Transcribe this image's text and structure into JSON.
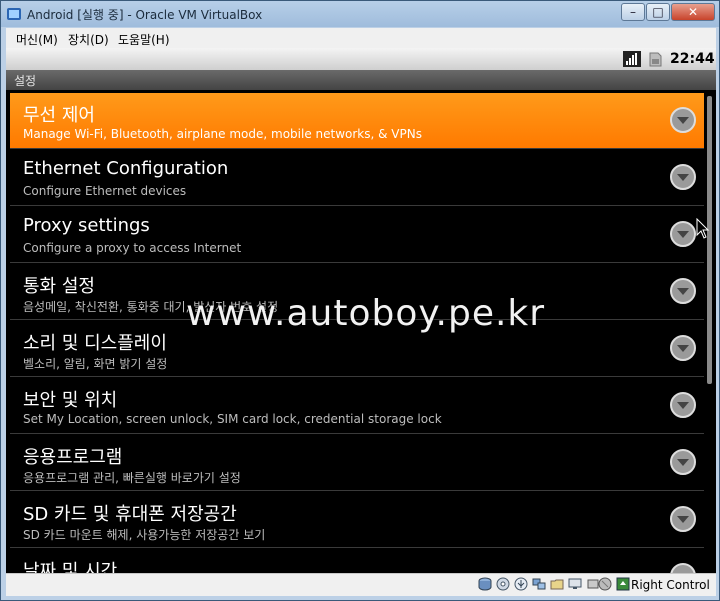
{
  "window": {
    "title": "Android [실행 중] - Oracle VM VirtualBox"
  },
  "menubar": {
    "items": [
      "머신(M)",
      "장치(D)",
      "도움말(H)"
    ]
  },
  "status": {
    "time": "22:44"
  },
  "appbar": {
    "title": "설정"
  },
  "settings": [
    {
      "title": "무선 제어",
      "subtitle": "Manage Wi-Fi, Bluetooth, airplane mode, mobile networks, & VPNs"
    },
    {
      "title": "Ethernet Configuration",
      "subtitle": "Configure Ethernet devices"
    },
    {
      "title": "Proxy settings",
      "subtitle": "Configure a proxy to access Internet"
    },
    {
      "title": "통화 설정",
      "subtitle": "음성메일, 착신전환, 통화중 대기, 발신자 번호 설정"
    },
    {
      "title": "소리 및 디스플레이",
      "subtitle": "벨소리, 알림, 화면 밝기 설정"
    },
    {
      "title": "보안 및 위치",
      "subtitle": "Set My Location, screen unlock, SIM card lock, credential storage lock"
    },
    {
      "title": "응용프로그램",
      "subtitle": "응용프로그램 관리, 빠른실행 바로가기 설정"
    },
    {
      "title": "SD 카드 및 휴대폰 저장공간",
      "subtitle": "SD 카드 마운트 해제, 사용가능한 저장공간 보기"
    },
    {
      "title": "날짜 및 시간",
      "subtitle": ""
    }
  ],
  "watermark": "www.autoboy.pe.kr",
  "vbox_status": {
    "host_key_label": "Right Control"
  },
  "colors": {
    "selected": "#ff8800",
    "list_bg": "#000000",
    "divider": "#3a3a3a"
  }
}
